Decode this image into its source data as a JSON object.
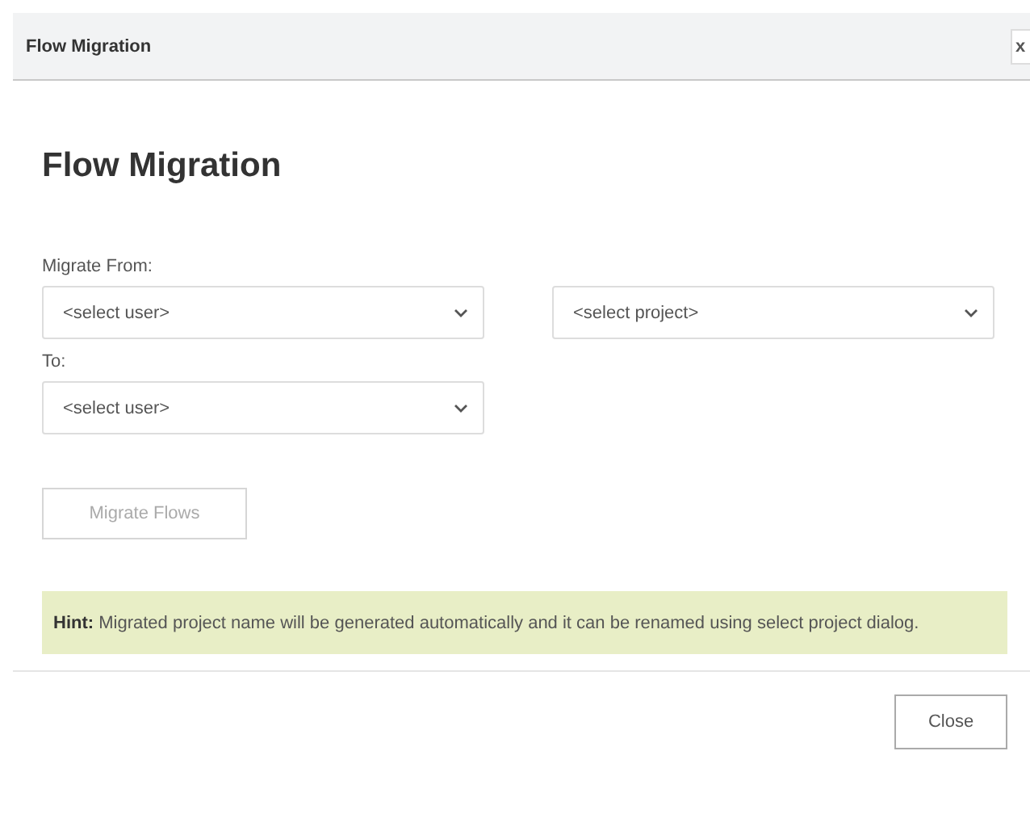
{
  "window": {
    "title": "Flow Migration",
    "close": "x"
  },
  "heading": "Flow Migration",
  "from": {
    "label": "Migrate From:",
    "selects": [
      {
        "placeholder": "<select user>"
      },
      {
        "placeholder": "<select project>"
      }
    ]
  },
  "to": {
    "label": "To:",
    "selects": [
      {
        "placeholder": "<select user>"
      }
    ]
  },
  "migrate_button": {
    "label": "Migrate Flows",
    "disabled": true
  },
  "hint": "**Hint:** Migrated project name will be generated automatically and it can be renamed using select project dialog.",
  "footer": {
    "buttons": [
      "Close"
    ]
  }
}
